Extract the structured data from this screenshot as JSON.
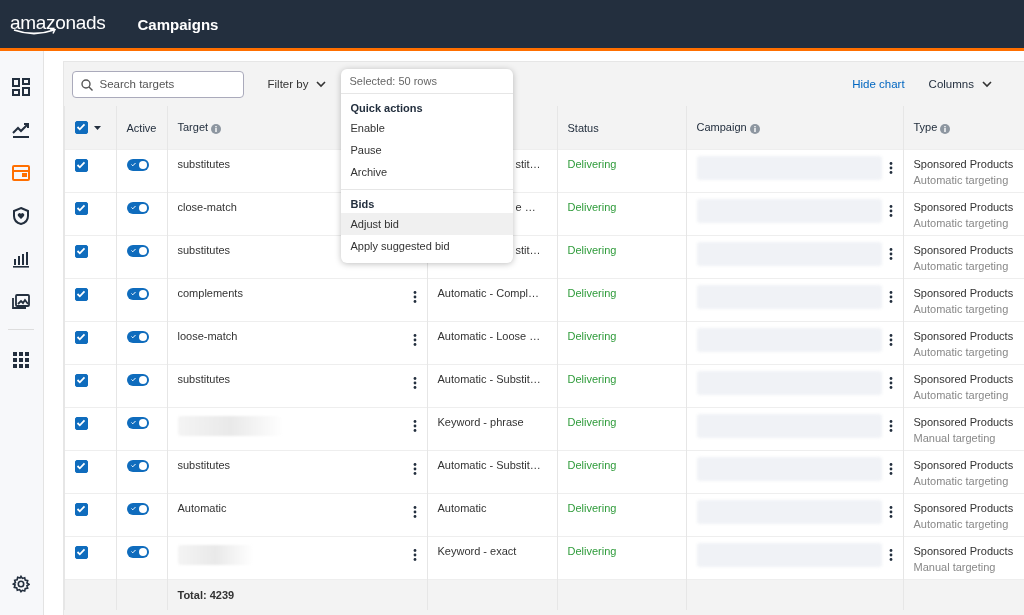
{
  "header": {
    "logo": "amazonads",
    "title": "Campaigns"
  },
  "sidebar": {
    "items": [
      {
        "selected": false
      },
      {
        "selected": false
      },
      {
        "selected": true
      },
      {
        "selected": false
      },
      {
        "selected": false
      },
      {
        "selected": false
      },
      {
        "selected": false
      }
    ]
  },
  "toolbar": {
    "search": {
      "placeholder": "Search targets"
    },
    "filter": "Filter by",
    "hide_chart": "Hide chart",
    "columns": "Columns"
  },
  "popup": {
    "header": "Selected: 50 rows",
    "groups": [
      {
        "title": "Quick actions",
        "items": [
          {
            "label": "Enable",
            "selected": false
          },
          {
            "label": "Pause",
            "selected": false
          },
          {
            "label": "Archive",
            "selected": false
          }
        ]
      },
      {
        "title": "Bids",
        "items": [
          {
            "label": "Adjust bid",
            "selected": true
          },
          {
            "label": "Apply suggested bid",
            "selected": false
          }
        ]
      }
    ]
  },
  "table": {
    "select_all": {
      "checked": true
    },
    "columns": [
      {
        "label": "Active",
        "info": false
      },
      {
        "label": "Target",
        "info": true
      },
      {
        "label": "Status",
        "info": false
      },
      {
        "label": "Campaign",
        "info": true
      },
      {
        "label": "Type",
        "info": true
      }
    ],
    "rows": [
      {
        "checked": true,
        "on": true,
        "target": {
          "kind": "text",
          "text": "substitutes"
        },
        "menu": false,
        "match": {
          "text": "stit…",
          "covered": true
        },
        "status": "Delivering",
        "type": "Sponsored Products",
        "subtype": "Automatic targeting"
      },
      {
        "checked": true,
        "on": true,
        "target": {
          "kind": "text",
          "text": "close-match"
        },
        "menu": false,
        "match": {
          "text": "e …",
          "covered": true
        },
        "status": "Delivering",
        "type": "Sponsored Products",
        "subtype": "Automatic targeting"
      },
      {
        "checked": true,
        "on": true,
        "target": {
          "kind": "text",
          "text": "substitutes"
        },
        "menu": false,
        "match": {
          "text": "stit…",
          "covered": true
        },
        "status": "Delivering",
        "type": "Sponsored Products",
        "subtype": "Automatic targeting"
      },
      {
        "checked": true,
        "on": true,
        "target": {
          "kind": "text",
          "text": "complements"
        },
        "menu": true,
        "match": {
          "text": "Automatic - Compl…",
          "covered": false
        },
        "status": "Delivering",
        "type": "Sponsored Products",
        "subtype": "Automatic targeting"
      },
      {
        "checked": true,
        "on": true,
        "target": {
          "kind": "text",
          "text": "loose-match"
        },
        "menu": true,
        "match": {
          "text": "Automatic - Loose …",
          "covered": false
        },
        "status": "Delivering",
        "type": "Sponsored Products",
        "subtype": "Automatic targeting"
      },
      {
        "checked": true,
        "on": true,
        "target": {
          "kind": "text",
          "text": "substitutes"
        },
        "menu": true,
        "match": {
          "text": "Automatic - Substit…",
          "covered": false
        },
        "status": "Delivering",
        "type": "Sponsored Products",
        "subtype": "Automatic targeting"
      },
      {
        "checked": true,
        "on": true,
        "target": {
          "kind": "blurred"
        },
        "menu": true,
        "match": {
          "text": "Keyword - phrase",
          "covered": false
        },
        "status": "Delivering",
        "type": "Sponsored Products",
        "subtype": "Manual targeting"
      },
      {
        "checked": true,
        "on": true,
        "target": {
          "kind": "text",
          "text": "substitutes"
        },
        "menu": true,
        "match": {
          "text": "Automatic - Substit…",
          "covered": false
        },
        "status": "Delivering",
        "type": "Sponsored Products",
        "subtype": "Automatic targeting"
      },
      {
        "checked": true,
        "on": true,
        "target": {
          "kind": "text",
          "text": "Automatic"
        },
        "menu": true,
        "match": {
          "text": "Automatic",
          "covered": false
        },
        "status": "Delivering",
        "type": "Sponsored Products",
        "subtype": "Automatic targeting"
      },
      {
        "checked": true,
        "on": true,
        "target": {
          "kind": "blurred"
        },
        "menu": true,
        "match": {
          "text": "Keyword - exact",
          "covered": false
        },
        "status": "Delivering",
        "type": "Sponsored Products",
        "subtype": "Manual targeting"
      }
    ],
    "total": "Total: 4239"
  }
}
